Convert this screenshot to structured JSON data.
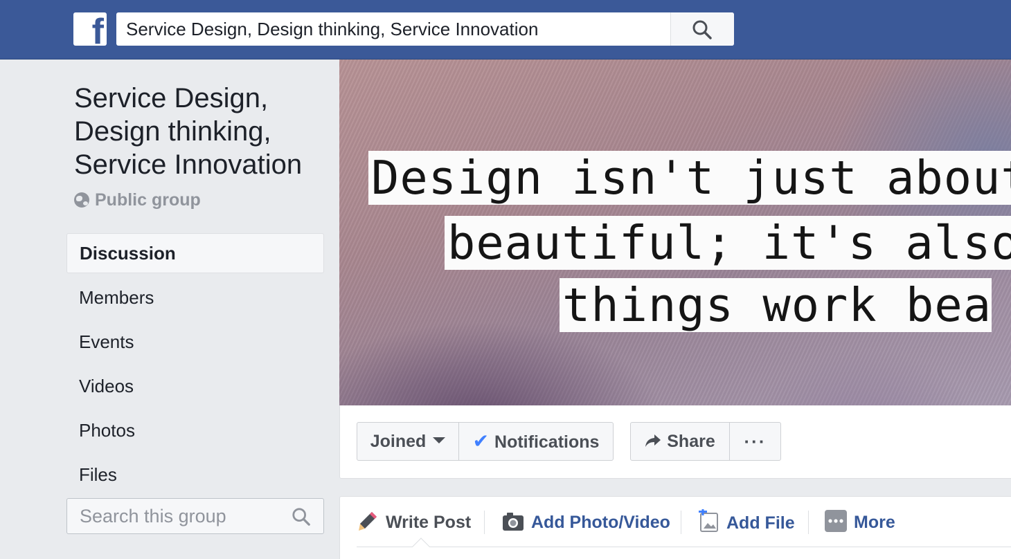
{
  "header": {
    "logo_letter": "f",
    "search_value": "Service Design, Design thinking, Service Innovation",
    "brand_color": "#3b5998"
  },
  "group": {
    "title_lines": [
      "Service Design,",
      "Design thinking,",
      "Service Innovation"
    ],
    "privacy": "Public group"
  },
  "sidebar": {
    "items": [
      {
        "label": "Discussion",
        "active": true
      },
      {
        "label": "Members"
      },
      {
        "label": "Events"
      },
      {
        "label": "Videos"
      },
      {
        "label": "Photos"
      },
      {
        "label": "Files"
      }
    ],
    "search_placeholder": "Search this group"
  },
  "cover": {
    "quote_lines": [
      "Design isn't just about",
      "beautiful; it's also a",
      "things work bea"
    ]
  },
  "actions": {
    "joined": "Joined",
    "notifications": "Notifications",
    "share": "Share",
    "more": "···"
  },
  "composer": {
    "write_post": "Write Post",
    "add_photo": "Add Photo/Video",
    "add_file": "Add File",
    "more": "More"
  }
}
